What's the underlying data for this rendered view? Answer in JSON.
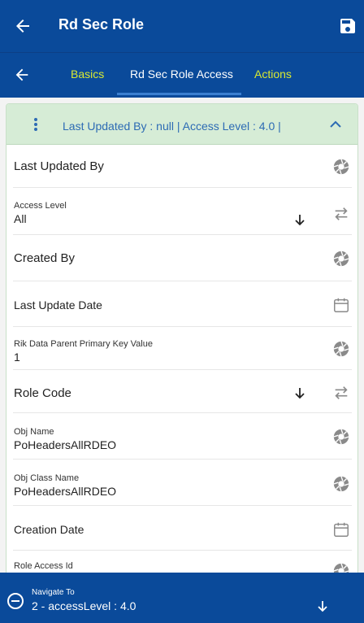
{
  "appbar": {
    "title": "Rd Sec Role",
    "back_icon": "arrow-left-icon",
    "save_icon": "save-icon"
  },
  "tabs": {
    "back_icon": "arrow-left-icon",
    "items": [
      {
        "label": "Basics"
      },
      {
        "label": "Rd Sec Role Access",
        "active": true
      },
      {
        "label": "Actions"
      }
    ],
    "accent_color": "#d8e832"
  },
  "card": {
    "summary": "Last Updated By  : null | Access Level  : 4.0 |",
    "menu_icon": "vertical-dots-icon",
    "collapse_icon": "chevron-up-icon",
    "fields": [
      {
        "label": "Last Updated By",
        "value": "",
        "icon": "aperture-icon"
      },
      {
        "label": "Access Level",
        "value": "All",
        "icon": "swap-icon"
      },
      {
        "label": "Created By",
        "value": "",
        "icon": "aperture-icon"
      },
      {
        "label": "Last Update Date",
        "value": "",
        "icon": "calendar-icon"
      },
      {
        "label": "Rik Data Parent Primary Key Value",
        "value": "1",
        "icon": "aperture-icon"
      },
      {
        "label": "Role Code",
        "value": "",
        "icon": "swap-icon"
      },
      {
        "label": "Obj Name",
        "value": "PoHeadersAllRDEO",
        "icon": "aperture-icon"
      },
      {
        "label": "Obj Class Name",
        "value": "PoHeadersAllRDEO",
        "icon": "aperture-icon"
      },
      {
        "label": "Creation Date",
        "value": "",
        "icon": "calendar-icon"
      },
      {
        "label": "Role Access Id",
        "value": "",
        "icon": "aperture-icon"
      }
    ]
  },
  "bottom": {
    "nav_label": "Navigate To",
    "nav_value": "2 - accessLevel : 4.0",
    "minus_icon": "minus-circle-icon",
    "chevron_icon": "chevron-down-icon"
  },
  "colors": {
    "primary": "#0a4a9a",
    "card_header": "#d6ecd6",
    "summary_text": "#2d6bb4"
  }
}
